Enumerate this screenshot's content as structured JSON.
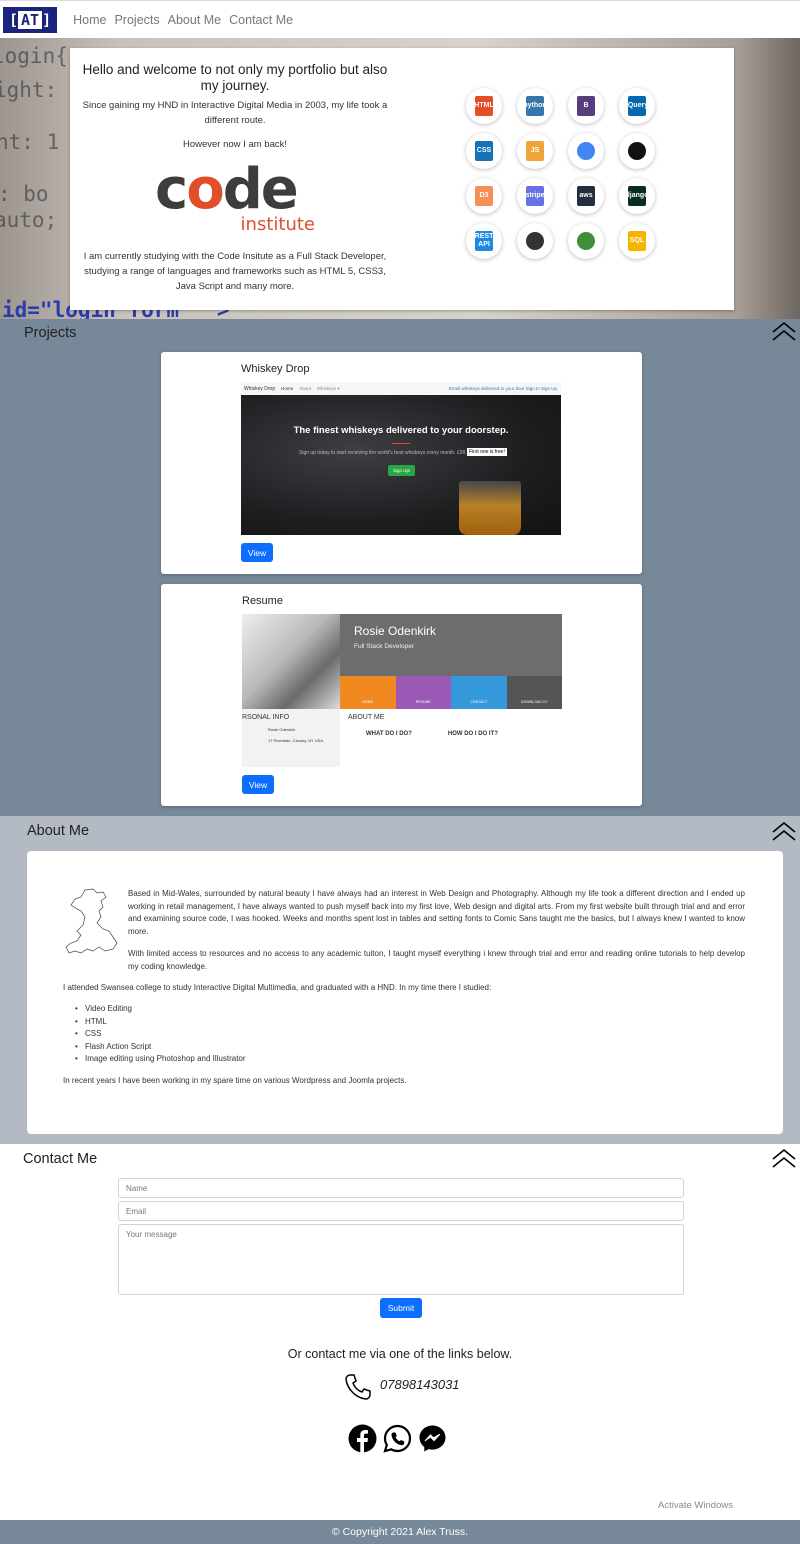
{
  "nav": {
    "brand": "AT",
    "links": [
      "Home",
      "Projects",
      "About Me",
      "Contact Me"
    ]
  },
  "hero": {
    "heading": "Hello and welcome to not only my portfolio but also my journey.",
    "intro": "Since gaining my HND in Interactive Digital Media in 2003, my life took a different route.",
    "back": "However now I am back!",
    "logo": {
      "word_a": "c",
      "word_o": "o",
      "word_b": "de",
      "sub": "institute"
    },
    "studying": "I am currently studying with the Code Insitute as a Full Stack Developer, studying a range of languages and frameworks such as HTML 5, CSS3, Java Script and many more.",
    "background_code": [
      "login{",
      "ight: 1",
      "ht: 1",
      ": bo",
      "auto;",
      "id=\"login form\"  >"
    ],
    "tech": [
      {
        "icon": "html5-icon",
        "label": "HTML",
        "color": "#e44d26"
      },
      {
        "icon": "python-icon",
        "label": "python",
        "color": "#3776ab"
      },
      {
        "icon": "bootstrap-icon",
        "label": "B",
        "color": "#563d7c"
      },
      {
        "icon": "jquery-icon",
        "label": "jQuery",
        "color": "#0769ad"
      },
      {
        "icon": "css3-icon",
        "label": "CSS",
        "color": "#1572b6"
      },
      {
        "icon": "javascript-icon",
        "label": "JS",
        "color": "#f0a53a"
      },
      {
        "icon": "google-dev-icon",
        "label": "",
        "color": "#4285f4"
      },
      {
        "icon": "github-icon",
        "label": "",
        "color": "#111111"
      },
      {
        "icon": "d3-crossfilter-icon",
        "label": "D3",
        "color": "#f68e56"
      },
      {
        "icon": "stripe-icon",
        "label": "stripe",
        "color": "#6772e5"
      },
      {
        "icon": "aws-icon",
        "label": "aws",
        "color": "#232f3e"
      },
      {
        "icon": "django-icon",
        "label": "django",
        "color": "#092e20"
      },
      {
        "icon": "rest-api-icon",
        "label": "REST API",
        "color": "#1e88e5"
      },
      {
        "icon": "heroku-icon",
        "label": "",
        "color": "#333333"
      },
      {
        "icon": "mongodb-icon",
        "label": "",
        "color": "#3f8f3a"
      },
      {
        "icon": "sql-icon",
        "label": "SQL",
        "color": "#f4b400"
      }
    ]
  },
  "projects": {
    "title": "Projects",
    "cards": [
      {
        "title": "Whiskey Drop",
        "view_label": "View",
        "shot": {
          "nav_brand": "Whiskey Drop",
          "nav_links": [
            "Home",
            "About",
            "Whiskeys ▾"
          ],
          "nav_right": "Email whiskeys delivered to your door  Sign In  Sign Up",
          "headline": "The finest whiskeys delivered to your doorstep.",
          "subline": "Sign up today to start receiving the world's best whiskeys every month. £99.99",
          "badge": "First one is free!",
          "button": "Sign Up!"
        }
      },
      {
        "title": "Resume",
        "view_label": "View",
        "shot": {
          "name": "Rosie Odenkirk",
          "role": "Full Stack Developer",
          "tabs": [
            {
              "label": "HOME",
              "color": "#f0891f"
            },
            {
              "label": "RESUME",
              "color": "#9b59b6"
            },
            {
              "label": "CONTACT",
              "color": "#3498db"
            },
            {
              "label": "DOWNLOAD CV",
              "color": "#555555"
            }
          ],
          "personal_heading": "RSONAL INFO",
          "personal_rows": [
            "Rosie Odenkirk",
            "17 Riverdale, Cavalry, NY USA"
          ],
          "about_heading": "ABOUT ME",
          "what_heading": "WHAT DO I DO?",
          "how_heading": "HOW DO I DO IT?"
        }
      }
    ]
  },
  "about": {
    "title": "About Me",
    "p1": "Based in Mid-Wales, surrounded by natural beauty I have always had an interest in Web Design and Photography. Although my life took a different direction and I ended up working in retail management, I have always wanted to push myself back into my first love, Web design and digital arts. From my first website built through trial and and error and examining source code, I was hooked. Weeks and months spent lost in tables and setting fonts to Comic Sans taught me the basics, but I always knew I wanted to know more.",
    "p2": "With limited access to resources and no access to any academic tuiton, I taught myself everything i knew through trial and error and reading online tutorials to help develop my coding knowledge.",
    "p3": "I attended Swansea college to study Interactive Digital Multimedia, and graduated with a HND. In my time there I studied:",
    "items": [
      "Video Editing",
      "HTML",
      "CSS",
      "Flash Action Script",
      "Image editing using Photoshop and Illustrator"
    ],
    "p4": "In recent years I have been working in my spare time on various Wordpress and Joomla projects."
  },
  "contact": {
    "title": "Contact Me",
    "name_placeholder": "Name",
    "email_placeholder": "Email",
    "message_placeholder": "Your message",
    "submit_label": "Submit",
    "or_text": "Or contact me via one of the links below.",
    "phone": "07898143031",
    "socials": [
      "facebook-icon",
      "whatsapp-icon",
      "messenger-icon"
    ]
  },
  "footer": {
    "copyright": "© Copyright 2021 Alex Truss."
  },
  "watermark": {
    "line1": "Activate Windows"
  }
}
